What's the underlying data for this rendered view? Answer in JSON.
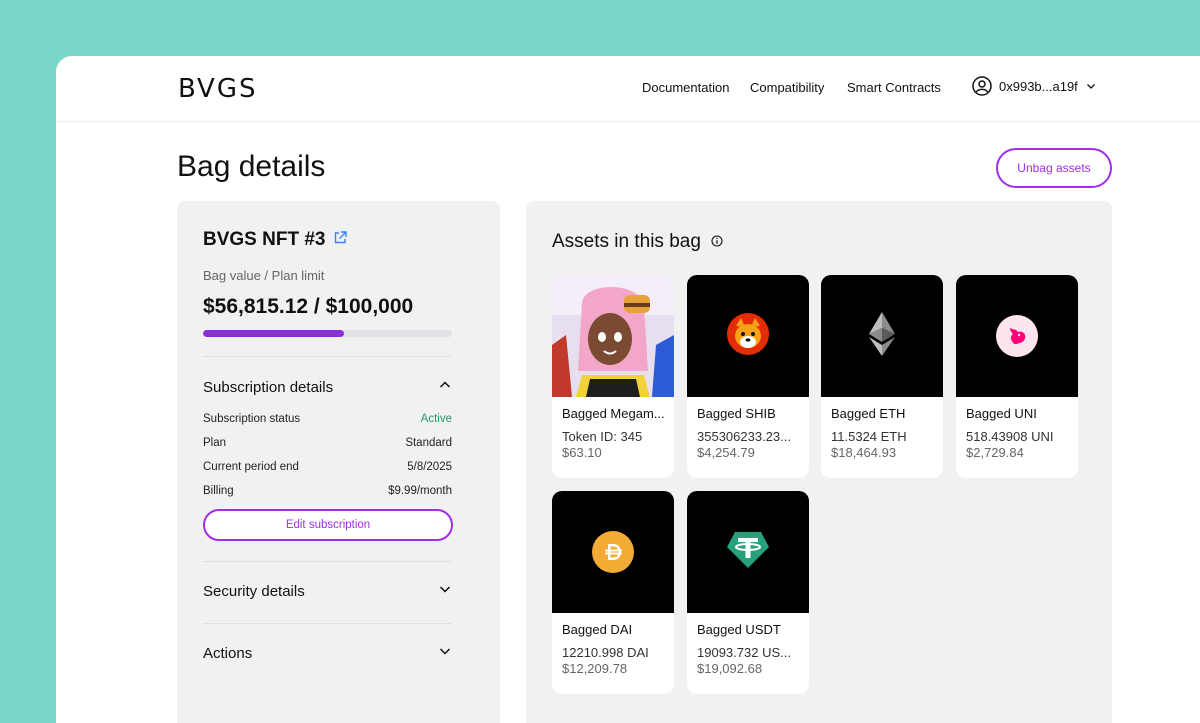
{
  "header": {
    "logo": "BVGS",
    "nav": [
      "Documentation",
      "Compatibility",
      "Smart Contracts"
    ],
    "wallet_address": "0x993b...a19f"
  },
  "page": {
    "title": "Bag details",
    "unbag_label": "Unbag assets"
  },
  "bag": {
    "nft_title": "BVGS NFT #3",
    "value_label": "Bag value / Plan limit",
    "value_text": "$56,815.12 / $100,000",
    "progress": 0.568
  },
  "subscription": {
    "title": "Subscription details",
    "rows": [
      {
        "label": "Subscription status",
        "value": "Active"
      },
      {
        "label": "Plan",
        "value": "Standard"
      },
      {
        "label": "Current period end",
        "value": "5/8/2025"
      },
      {
        "label": "Billing",
        "value": "$9.99/month"
      }
    ],
    "edit_label": "Edit subscription"
  },
  "sections": {
    "security": "Security details",
    "actions": "Actions"
  },
  "assets": {
    "title": "Assets in this bag",
    "items": [
      {
        "name": "Bagged Megam...",
        "amount": "Token ID: 345",
        "usd": "$63.10",
        "icon": "nft-artwork"
      },
      {
        "name": "Bagged SHIB",
        "amount": "355306233.23...",
        "usd": "$4,254.79",
        "icon": "shib-icon"
      },
      {
        "name": "Bagged ETH",
        "amount": "11.5324 ETH",
        "usd": "$18,464.93",
        "icon": "eth-icon"
      },
      {
        "name": "Bagged UNI",
        "amount": "518.43908 UNI",
        "usd": "$2,729.84",
        "icon": "uni-icon"
      },
      {
        "name": "Bagged DAI",
        "amount": "12210.998 DAI",
        "usd": "$12,209.78",
        "icon": "dai-icon"
      },
      {
        "name": "Bagged USDT",
        "amount": "19093.732 US...",
        "usd": "$19,092.68",
        "icon": "usdt-icon"
      }
    ]
  },
  "colors": {
    "accent": "#a12ee6",
    "progress": "#8a2fd8",
    "active_status": "#2a9a6a",
    "backdrop": "#7dd6cb"
  }
}
